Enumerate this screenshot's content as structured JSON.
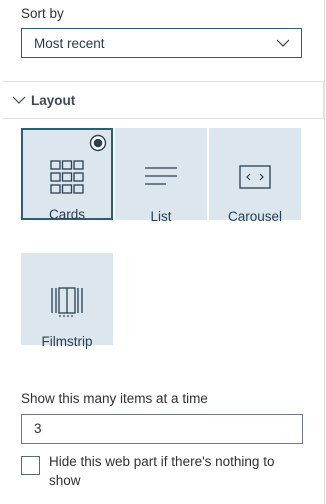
{
  "sort": {
    "label": "Sort by",
    "selected": "Most recent"
  },
  "layout": {
    "header": "Layout",
    "options": [
      {
        "label": "Cards",
        "selected": true,
        "icon": "grid-icon"
      },
      {
        "label": "List",
        "selected": false,
        "icon": "list-lines-icon"
      },
      {
        "label": "Carousel",
        "selected": false,
        "icon": "carousel-icon"
      },
      {
        "label": "Filmstrip",
        "selected": false,
        "icon": "filmstrip-icon"
      }
    ]
  },
  "items": {
    "label": "Show this many items at a time",
    "value": "3"
  },
  "hide": {
    "label": "Hide this web part if there's nothing to show",
    "checked": false
  },
  "colors": {
    "accent": "#2b5f73",
    "tile_bg": "#dce6ee"
  }
}
